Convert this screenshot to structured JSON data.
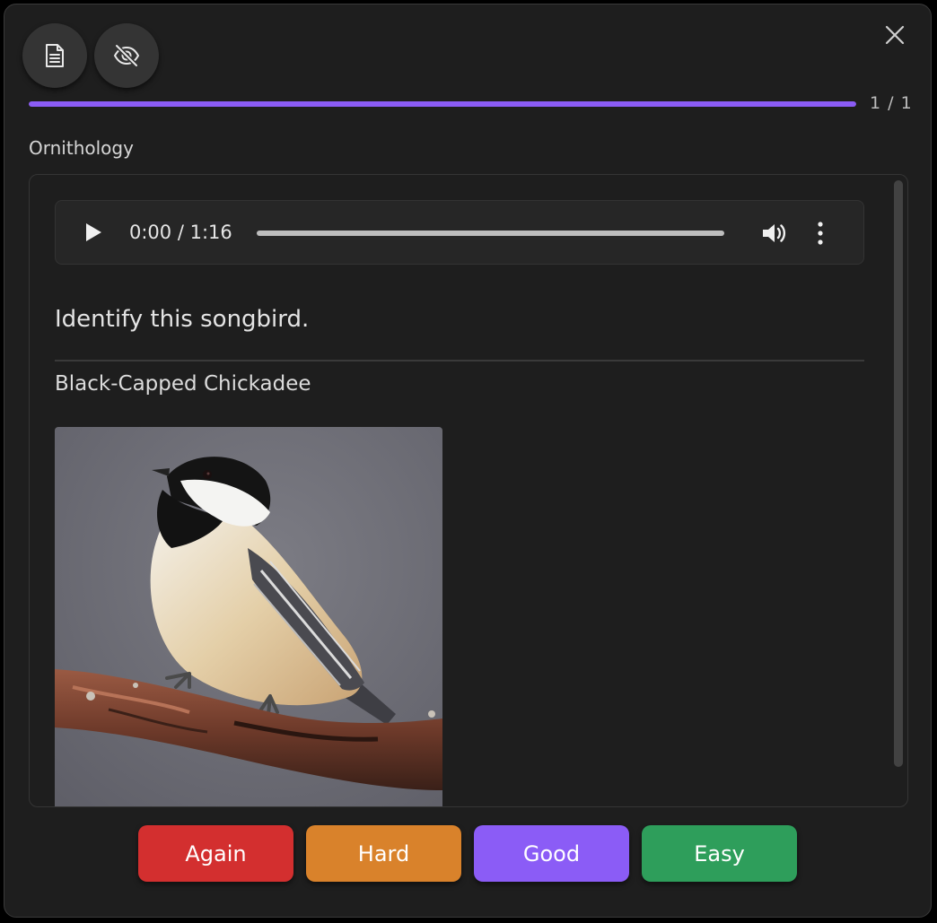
{
  "header": {
    "notes_icon": "file-text-icon",
    "hide_icon": "eye-off-icon",
    "close_icon": "close-icon"
  },
  "progress": {
    "current": 1,
    "total": 1,
    "text": "1 / 1",
    "fraction": 1.0,
    "color": "#8b5cf6"
  },
  "deck": {
    "name": "Ornithology"
  },
  "card": {
    "audio": {
      "time_text": "0:00 / 1:16",
      "position_fraction": 0.0,
      "play_icon": "play-icon",
      "volume_icon": "volume-icon",
      "more_icon": "more-vertical-icon"
    },
    "question": "Identify this songbird.",
    "answer": "Black-Capped Chickadee",
    "image_icon": "bird-photo"
  },
  "ratings": [
    {
      "label": "Again",
      "color": "#d32f2f"
    },
    {
      "label": "Hard",
      "color": "#d9822b"
    },
    {
      "label": "Good",
      "color": "#8b5cf6"
    },
    {
      "label": "Easy",
      "color": "#2e9e5b"
    }
  ]
}
